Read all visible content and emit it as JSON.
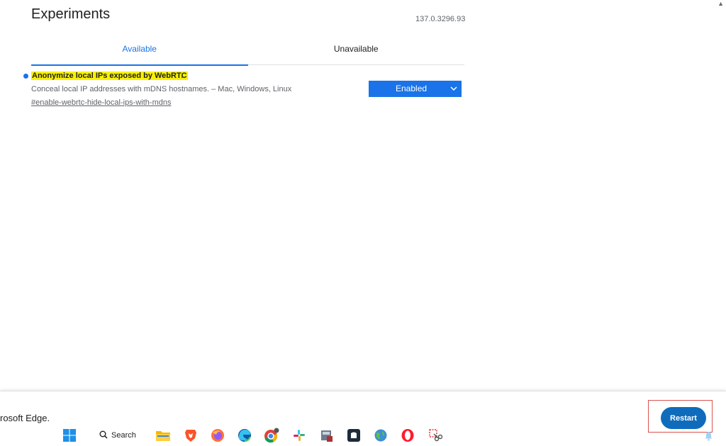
{
  "page": {
    "title": "Experiments",
    "version": "137.0.3296.93"
  },
  "tabs": [
    {
      "label": "Available"
    },
    {
      "label": "Unavailable"
    }
  ],
  "experiment": {
    "title": "Anonymize local IPs exposed by WebRTC",
    "title_tail": ".",
    "description": "Conceal local IP addresses with mDNS hostnames. – Mac, Windows, Linux",
    "link": "#enable-webrtc-hide-local-ips-with-mdns",
    "select_value": "Enabled"
  },
  "relaunch": {
    "message": "rosoft Edge.",
    "button_label": "Restart"
  },
  "taskbar": {
    "search_label": "Search",
    "icons": [
      "windows-start-icon",
      "file-explorer-icon",
      "brave-icon",
      "firefox-icon",
      "edge-icon",
      "chrome-icon",
      "slack-icon",
      "app-icon",
      "dark-app-icon",
      "globe-app-icon",
      "opera-icon",
      "snipping-tool-icon"
    ]
  },
  "colors": {
    "accent": "#1a73e8",
    "highlight": "#f8f000",
    "restart_button": "#0f6cbd",
    "highlight_box": "#d9534f"
  }
}
